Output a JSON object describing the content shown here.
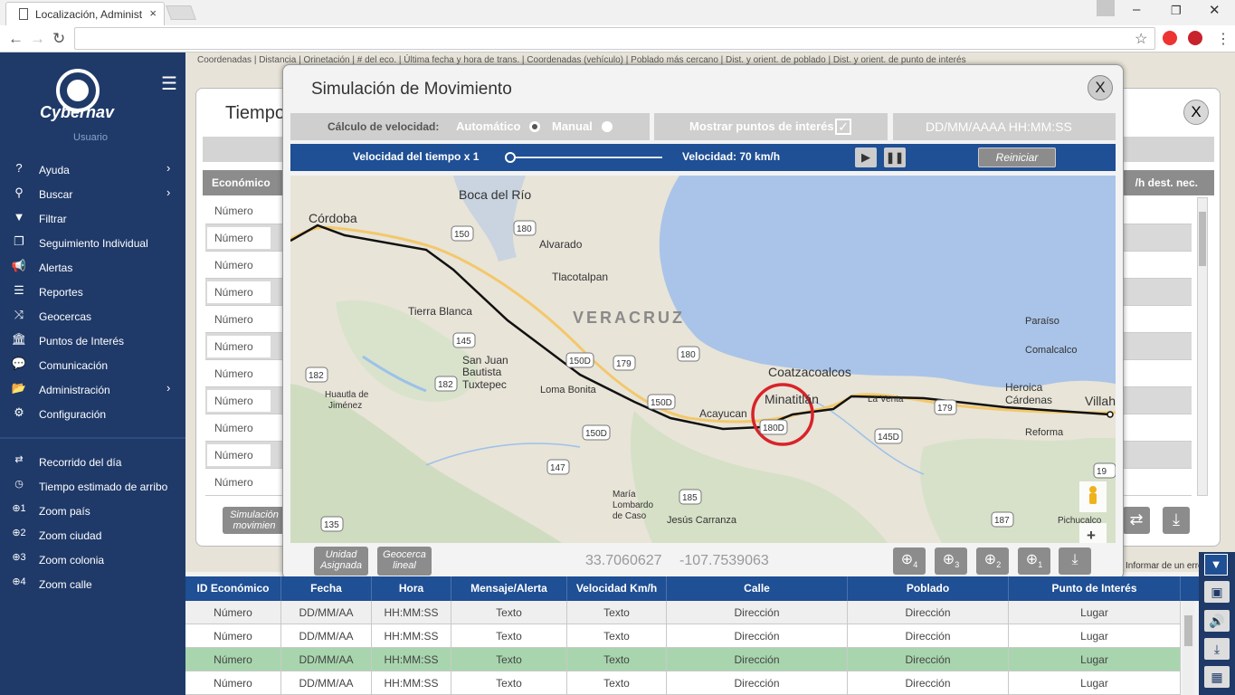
{
  "browser": {
    "tab_title": "Localización, Administrac",
    "tab_close": "×",
    "url": ""
  },
  "sidebar": {
    "brand": "Cybernav",
    "user": "Usuario",
    "items": [
      {
        "label": "Ayuda",
        "icon": "question-icon",
        "glyph": "?",
        "arrow": true
      },
      {
        "label": "Buscar",
        "icon": "search-icon",
        "glyph": "⚲",
        "arrow": true
      },
      {
        "label": "Filtrar",
        "icon": "filter-icon",
        "glyph": "▼",
        "arrow": false
      },
      {
        "label": "Seguimiento Individual",
        "icon": "windows-icon",
        "glyph": "❐",
        "arrow": false
      },
      {
        "label": "Alertas",
        "icon": "megaphone-icon",
        "glyph": "📢",
        "arrow": false
      },
      {
        "label": "Reportes",
        "icon": "list-icon",
        "glyph": "☰",
        "arrow": false
      },
      {
        "label": "Geocercas",
        "icon": "shuffle-icon",
        "glyph": "⤨",
        "arrow": false
      },
      {
        "label": "Puntos de Interés",
        "icon": "bank-icon",
        "glyph": "🏛",
        "arrow": false
      },
      {
        "label": "Comunicación",
        "icon": "chat-icon",
        "glyph": "💬",
        "arrow": false
      },
      {
        "label": "Administración",
        "icon": "folder-icon",
        "glyph": "📂",
        "arrow": true
      },
      {
        "label": "Configuración",
        "icon": "gears-icon",
        "glyph": "⚙",
        "arrow": false
      }
    ],
    "items2": [
      {
        "label": "Recorrido del día",
        "icon": "retweet-icon",
        "glyph": "⇄"
      },
      {
        "label": "Tiempo estimado de arribo",
        "icon": "clock-icon",
        "glyph": "◷"
      },
      {
        "label": "Zoom país",
        "icon": "zoom1-icon",
        "glyph": "⊕1"
      },
      {
        "label": "Zoom ciudad",
        "icon": "zoom2-icon",
        "glyph": "⊕2"
      },
      {
        "label": "Zoom colonia",
        "icon": "zoom3-icon",
        "glyph": "⊕3"
      },
      {
        "label": "Zoom calle",
        "icon": "zoom4-icon",
        "glyph": "⊕4"
      }
    ]
  },
  "background": {
    "coords_header": "Coordenadas | Distancia | Orinetación | # del eco. | Última fecha y hora de trans. | Coordenadas (vehículo) | Poblado más cercano | Dist. y orient. de poblado | Dist. y orient. de punto de interés",
    "panel_title": "Tiempo",
    "col_economico": "Económico",
    "col_right": "/h dest. nec.",
    "close": "X",
    "row_value": "Número",
    "sim_button": "Simulación movimien",
    "error_text": "Informar de un error de"
  },
  "modal": {
    "title": "Simulación de Movimiento",
    "close": "X",
    "calc_label": "Cálculo de velocidad:",
    "auto_label": "Automático",
    "manual_label": "Manual",
    "poi_label": "Mostrar puntos de interés",
    "poi_checked": "✓",
    "datetime_placeholder": "DD/MM/AAAA   HH:MM:SS",
    "time_speed": "Velocidad del tiempo x 1",
    "speed": "Velocidad: 70 km/h",
    "play": "▶",
    "pause": "❚❚",
    "reset": "Reiniciar",
    "unit_button": "Unidad Asignada",
    "geofence_button": "Geocerca lineal",
    "coord_lat": "33.7060627",
    "coord_lon": "-107.7539063",
    "zoom_labels": [
      "4",
      "3",
      "2",
      "1"
    ]
  },
  "map": {
    "places": [
      "Boca del Río",
      "Córdoba",
      "Alvarado",
      "Tlacotalpan",
      "Tierra Blanca",
      "VERACRUZ",
      "San Juan",
      "Bautista",
      "Tuxtepec",
      "Loma Bonita",
      "Huautla de",
      "Jiménez",
      "Acayucan",
      "Minatitlán",
      "Coatzacoalcos",
      "La Venta",
      "Heroica",
      "Cárdenas",
      "Villaher",
      "Paraíso",
      "Comalcalco",
      "Reforma",
      "María",
      "Lombardo",
      "de Caso",
      "Jesús Carranza",
      "Pichucalco"
    ],
    "shields": [
      "150",
      "180",
      "145",
      "150D",
      "179",
      "180",
      "182",
      "182",
      "150D",
      "150D",
      "179",
      "145D",
      "180D",
      "147",
      "185",
      "187",
      "19",
      "135"
    ],
    "zoom_plus": "+"
  },
  "table": {
    "headers": [
      "ID Económico",
      "Fecha",
      "Hora",
      "Mensaje/Alerta",
      "Velocidad Km/h",
      "Calle",
      "Poblado",
      "Punto de Interés"
    ],
    "rows": [
      [
        "Número",
        "DD/MM/AA",
        "HH:MM:SS",
        "Texto",
        "Texto",
        "Dirección",
        "Dirección",
        "Lugar"
      ],
      [
        "Número",
        "DD/MM/AA",
        "HH:MM:SS",
        "Texto",
        "Texto",
        "Dirección",
        "Dirección",
        "Lugar"
      ],
      [
        "Número",
        "DD/MM/AA",
        "HH:MM:SS",
        "Texto",
        "Texto",
        "Dirección",
        "Dirección",
        "Lugar"
      ],
      [
        "Número",
        "DD/MM/AA",
        "HH:MM:SS",
        "Texto",
        "Texto",
        "Dirección",
        "Dirección",
        "Lugar"
      ]
    ],
    "highlight_row": 2
  },
  "colors": {
    "sidebar": "#1f3a69",
    "accent_blue": "#1f4f94",
    "highlight": "#a8d5ad",
    "route": "#111111",
    "marker": "#d8232a"
  }
}
